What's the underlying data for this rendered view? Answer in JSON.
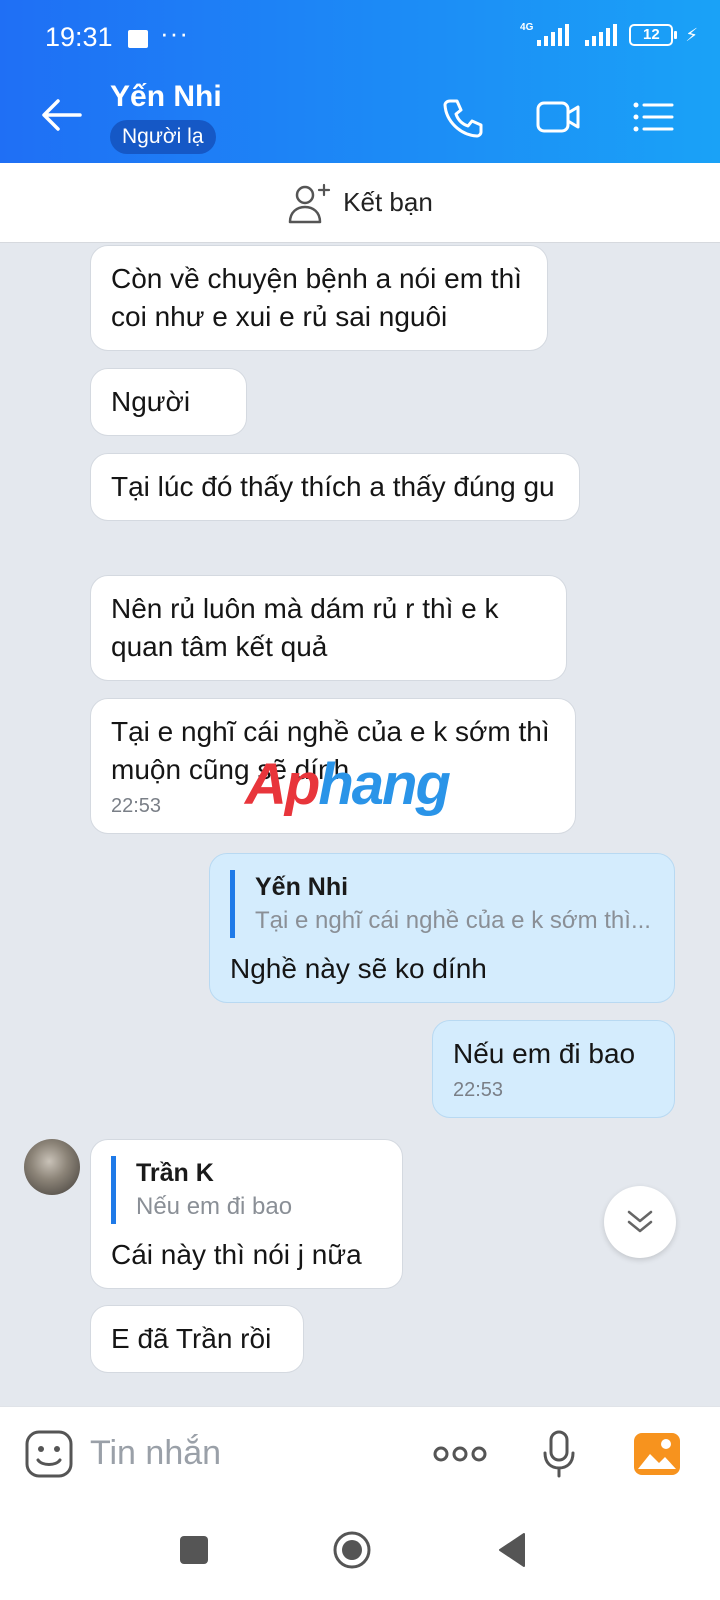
{
  "status_bar": {
    "time": "19:31",
    "network": "4G",
    "battery": "12"
  },
  "header": {
    "contact_name": "Yến Nhi",
    "badge": "Người lạ"
  },
  "friend_bar": {
    "label": "Kết bạn"
  },
  "messages": [
    {
      "text": "Còn về chuyện bệnh a nói em thì coi như e xui e rủ sai nguôi"
    },
    {
      "text": "Người"
    },
    {
      "text": "Tại lúc đó thấy thích a thấy đúng gu"
    },
    {
      "text": "Nên rủ luôn mà dám rủ r thì e k quan tâm kết quả"
    },
    {
      "text": "Tại e nghĩ cái nghề của e k sớm thì muộn cũng sẽ dính",
      "time": "22:53"
    },
    {
      "quote_name": "Yến Nhi",
      "quote_text": "Tại e nghĩ cái nghề của e k sớm thì...",
      "text": "Nghề này sẽ ko dính"
    },
    {
      "text": "Nếu em đi bao",
      "time": "22:53"
    },
    {
      "quote_name": "Trần K",
      "quote_text": "Nếu em đi bao",
      "text": "Cái này thì nói j nữa"
    },
    {
      "text": "E đã Trần rồi"
    }
  ],
  "watermark": {
    "part1": "Ap",
    "part2": "hang"
  },
  "input": {
    "placeholder": "Tin nhắn"
  },
  "colors": {
    "header_start": "#1f6ff5",
    "header_end": "#1aa2f7",
    "outgoing_bubble": "#d4ecfd",
    "chat_bg": "#e4e8ee"
  }
}
